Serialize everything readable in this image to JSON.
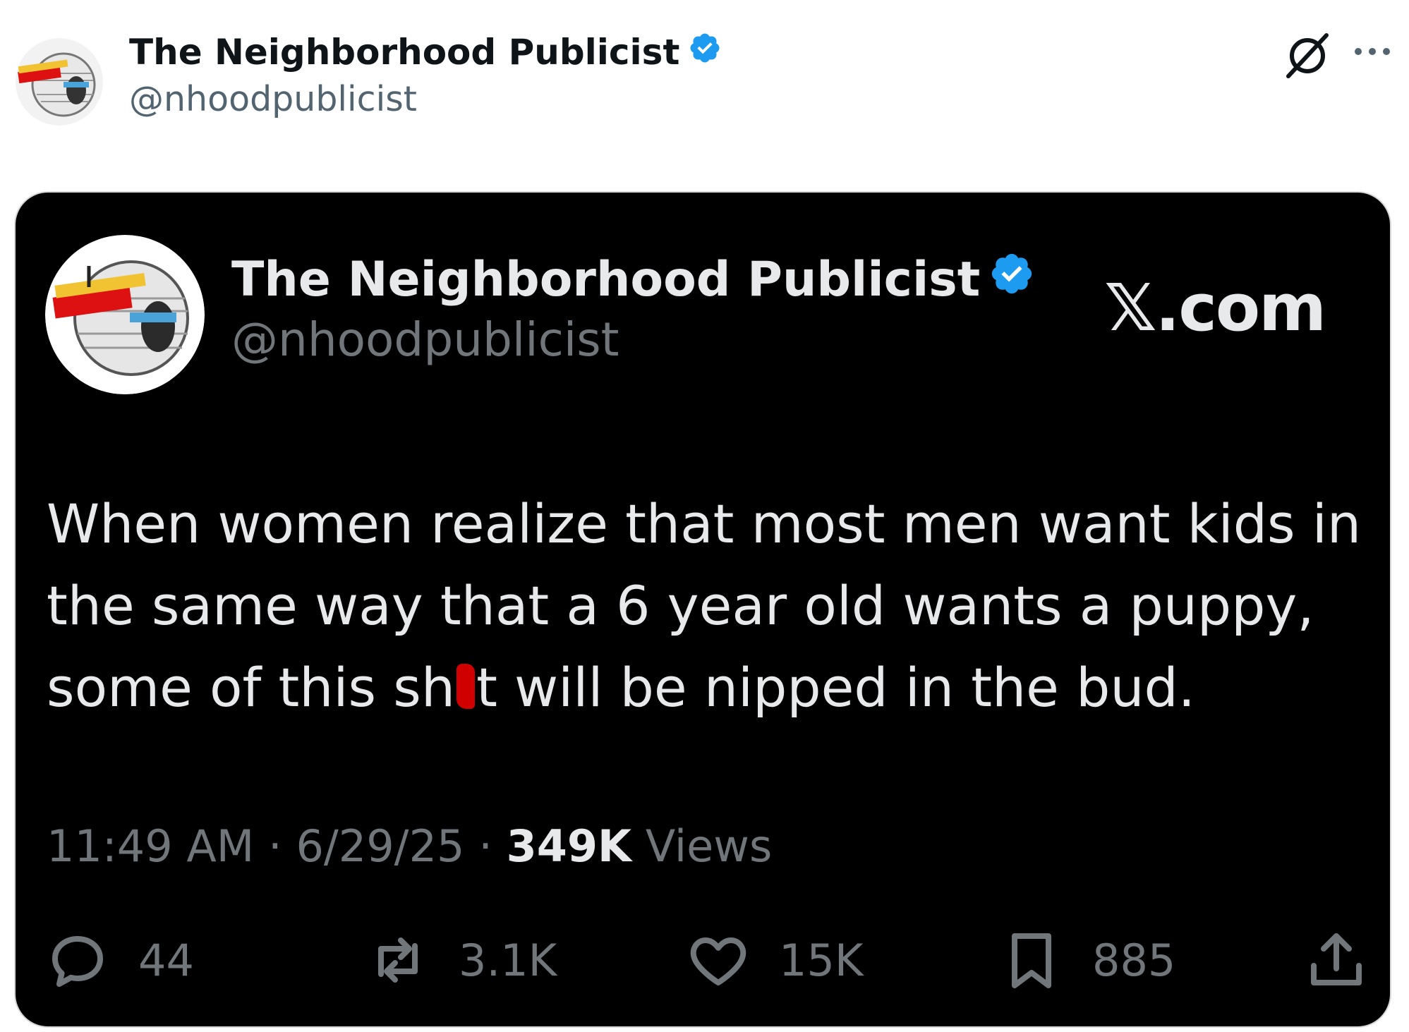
{
  "post": {
    "author_name": "The Neighborhood Publicist",
    "author_handle": "@nhoodpublicist"
  },
  "embedded": {
    "author_name": "The Neighborhood Publicist",
    "author_handle": "@nhoodpublicist",
    "brand_label": "𝕏.com",
    "text_lines": [
      "When women realize that most men want kids in",
      "the same way that a 6 year old wants a puppy,"
    ],
    "text_line3_before": "some of this sh",
    "text_line3_after": "t will be nipped in the bud.",
    "time": "11:49 AM",
    "date": "6/29/25",
    "views_count": "349K",
    "views_label": "Views",
    "separator": "·",
    "stats": {
      "replies": "44",
      "reposts": "3.1K",
      "likes": "15K",
      "bookmarks": "885"
    }
  },
  "colors": {
    "verified_badge": "#1d9bf0",
    "redaction": "#d10000",
    "card_bg": "#000000"
  },
  "icons": [
    "grok-icon",
    "more-icon",
    "verified-badge-icon",
    "reply-icon",
    "repost-icon",
    "like-icon",
    "bookmark-icon",
    "share-icon"
  ]
}
